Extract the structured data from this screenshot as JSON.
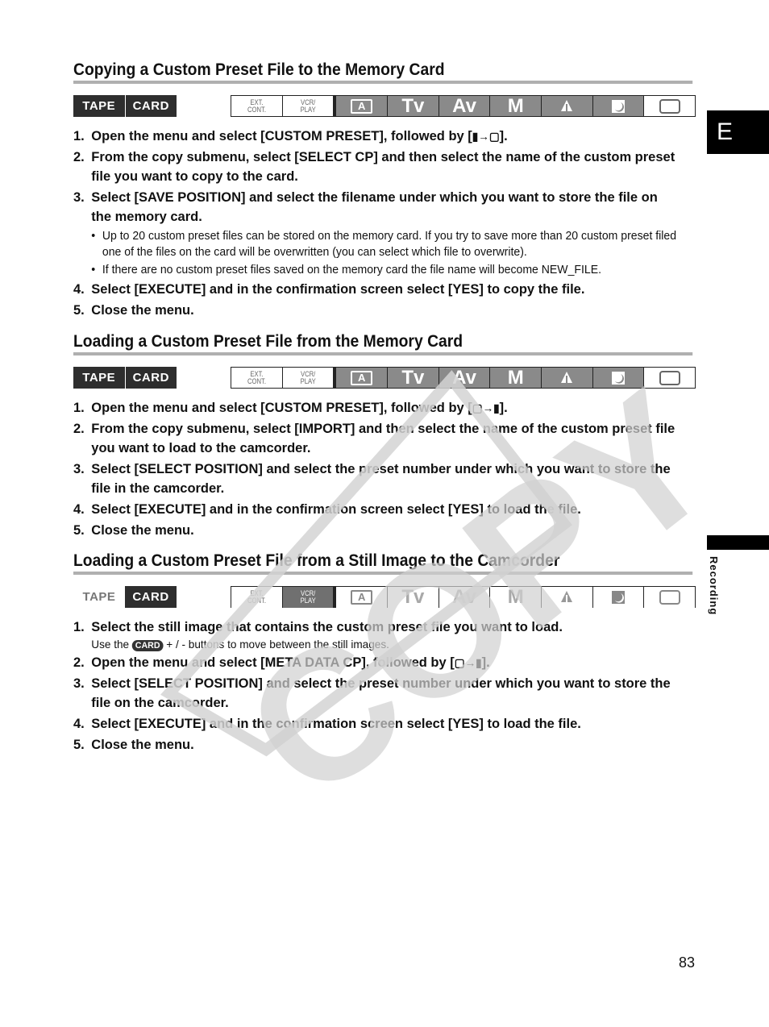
{
  "side_tabs": {
    "language": "E",
    "chapter": "Recording"
  },
  "page_number": "83",
  "watermark": "COPY",
  "mode_labels": {
    "tape": "TAPE",
    "card": "CARD",
    "ext_cont": [
      "EXT.",
      "CONT."
    ],
    "vcr_play": [
      "VCR/",
      "PLAY"
    ],
    "auto": "A",
    "tv": "Tv",
    "av": "Av",
    "m": "M"
  },
  "sections": [
    {
      "title": "Copying a Custom Preset File to the Memory Card",
      "active_media": "TAPE+CARD",
      "active_modes": [
        "A",
        "Tv",
        "Av",
        "M",
        "portrait/scene",
        "night",
        "no-flash-frame"
      ],
      "steps": [
        {
          "num": "1.",
          "text": "Open the menu and select [CUSTOM PRESET], followed by [",
          "icon": "camera-to-card",
          "tail": "]."
        },
        {
          "num": "2.",
          "text": "From the copy submenu, select [SELECT CP] and then select the name of the custom preset file you want to copy to the card."
        },
        {
          "num": "3.",
          "text": "Select [SAVE POSITION] and select the filename under which you want to store the file on the memory card.",
          "notes": [
            "Up to 20 custom preset files can be stored on the memory card. If you try to save more than 20 custom preset filed one of the files on the card will be overwritten (you can select which file to overwrite).",
            "If there are no custom preset files saved on the memory card the file name will become NEW_FILE."
          ]
        },
        {
          "num": "4.",
          "text": "Select [EXECUTE] and in the confirmation screen select [YES] to copy the file."
        },
        {
          "num": "5.",
          "text": "Close the menu."
        }
      ]
    },
    {
      "title": "Loading a Custom Preset File from the Memory Card",
      "active_media": "TAPE+CARD",
      "steps": [
        {
          "num": "1.",
          "text": "Open the menu and select [CUSTOM PRESET], followed by [",
          "icon": "card-to-camera",
          "tail": "]."
        },
        {
          "num": "2.",
          "text": "From the copy submenu, select [IMPORT] and then select the name of the custom preset file you want to load to the camcorder."
        },
        {
          "num": "3.",
          "text": "Select [SELECT POSITION] and select the preset number under which you want to store the file in the camcorder."
        },
        {
          "num": "4.",
          "text": "Select [EXECUTE] and in the confirmation screen select [YES] to load the file."
        },
        {
          "num": "5.",
          "text": "Close the menu."
        }
      ]
    },
    {
      "title": "Loading a Custom Preset File from a Still Image to the Camcorder",
      "active_media": "CARD",
      "active_modes": [
        "VCR/PLAY"
      ],
      "steps": [
        {
          "num": "1.",
          "text": "Select the still image that contains the custom preset file you want to load.",
          "sub": {
            "pre": "Use the",
            "badge": "CARD",
            "post": "+ / - buttons to move between the still images."
          }
        },
        {
          "num": "2.",
          "text": "Open the menu and select [META DATA CP], followed by [",
          "icon": "card-to-camera",
          "tail": "]."
        },
        {
          "num": "3.",
          "text": "Select [SELECT POSITION] and select the preset number under which you want to store the file on the camcorder."
        },
        {
          "num": "4.",
          "text": "Select [EXECUTE] and in the confirmation screen select [YES] to load the file."
        },
        {
          "num": "5.",
          "text": "Close the menu."
        }
      ]
    }
  ]
}
